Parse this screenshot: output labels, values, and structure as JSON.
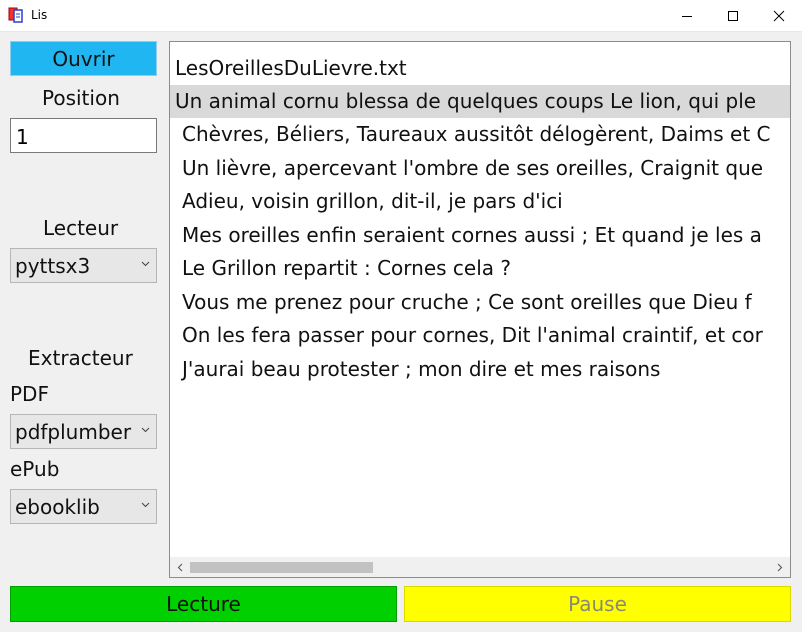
{
  "window": {
    "title": "Lis"
  },
  "sidebar": {
    "open_label": "Ouvrir",
    "position_label": "Position",
    "position_value": "1",
    "reader_label": "Lecteur",
    "reader_value": "pyttsx3",
    "extractor_label": "Extracteur",
    "pdf_label": "PDF",
    "pdf_value": "pdfplumber",
    "epub_label": "ePub",
    "epub_value": "ebooklib"
  },
  "listbox": {
    "lines": [
      "LesOreillesDuLievre.txt",
      "Un animal cornu blessa de quelques coups Le lion, qui ple",
      "Chèvres, Béliers, Taureaux aussitôt délogèrent, Daims et C",
      "Un lièvre, apercevant l'ombre de ses oreilles, Craignit que",
      "Adieu, voisin grillon, dit-il, je pars d'ici",
      "Mes oreilles enfin seraient cornes aussi ; Et quand je les a",
      "Le Grillon repartit : Cornes cela ?",
      "Vous me prenez pour cruche ; Ce sont oreilles que Dieu f",
      "On les fera passer pour cornes, Dit l'animal craintif, et cor",
      "J'aurai beau protester ; mon dire et mes raisons"
    ],
    "selected_index": 1
  },
  "controls": {
    "play_label": "Lecture",
    "pause_label": "Pause"
  },
  "colors": {
    "open": "#1fb6f2",
    "play": "#00d000",
    "pause": "#ffff00",
    "selection": "#d9d9d9"
  }
}
